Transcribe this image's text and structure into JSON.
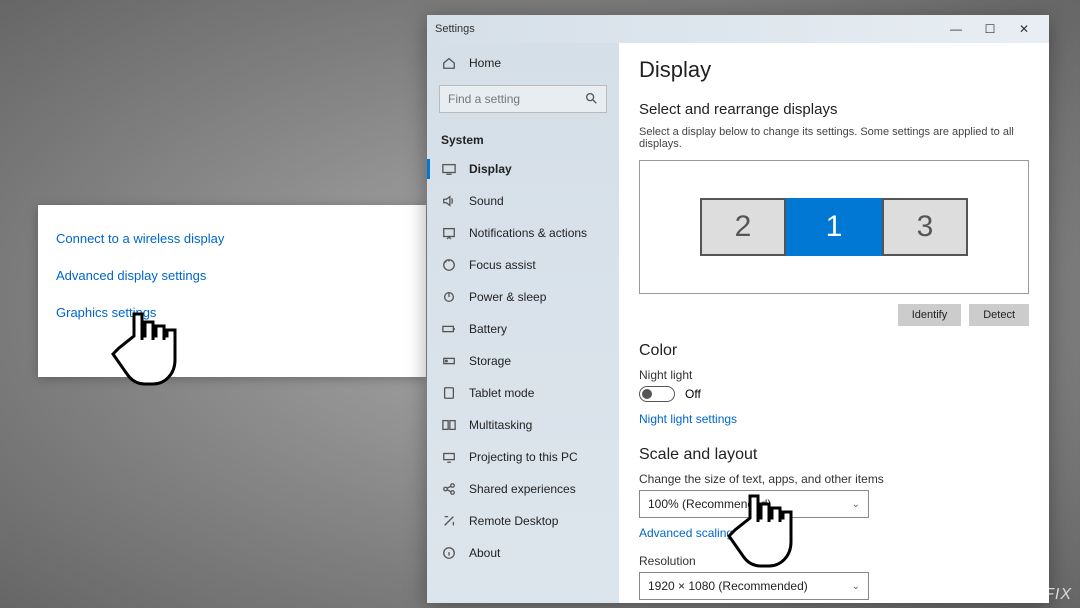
{
  "card": {
    "links": [
      "Connect to a wireless display",
      "Advanced display settings",
      "Graphics settings"
    ]
  },
  "window": {
    "title": "Settings",
    "controls": {
      "min": "—",
      "max": "☐",
      "close": "✕"
    }
  },
  "sidebar": {
    "home": "Home",
    "search_placeholder": "Find a setting",
    "section": "System",
    "items": [
      {
        "label": "Display",
        "icon": "display-icon",
        "active": true
      },
      {
        "label": "Sound",
        "icon": "sound-icon"
      },
      {
        "label": "Notifications & actions",
        "icon": "notifications-icon"
      },
      {
        "label": "Focus assist",
        "icon": "focus-assist-icon"
      },
      {
        "label": "Power & sleep",
        "icon": "power-icon"
      },
      {
        "label": "Battery",
        "icon": "battery-icon"
      },
      {
        "label": "Storage",
        "icon": "storage-icon"
      },
      {
        "label": "Tablet mode",
        "icon": "tablet-icon"
      },
      {
        "label": "Multitasking",
        "icon": "multitasking-icon"
      },
      {
        "label": "Projecting to this PC",
        "icon": "projecting-icon"
      },
      {
        "label": "Shared experiences",
        "icon": "shared-icon"
      },
      {
        "label": "Remote Desktop",
        "icon": "remote-icon"
      },
      {
        "label": "About",
        "icon": "about-icon"
      }
    ]
  },
  "main": {
    "title": "Display",
    "arrange_heading": "Select and rearrange displays",
    "arrange_hint": "Select a display below to change its settings. Some settings are applied to all displays.",
    "monitors": [
      {
        "label": "2",
        "selected": false
      },
      {
        "label": "1",
        "selected": true
      },
      {
        "label": "3",
        "selected": false
      }
    ],
    "identify_btn": "Identify",
    "detect_btn": "Detect",
    "color_heading": "Color",
    "night_light_label": "Night light",
    "night_light_state": "Off",
    "night_light_link": "Night light settings",
    "scale_heading": "Scale and layout",
    "scale_label": "Change the size of text, apps, and other items",
    "scale_value": "100% (Recommended)",
    "advanced_scaling_link": "Advanced scaling settings",
    "resolution_label": "Resolution",
    "resolution_value": "1920 × 1080 (Recommended)"
  },
  "watermark": "UGETFIX"
}
